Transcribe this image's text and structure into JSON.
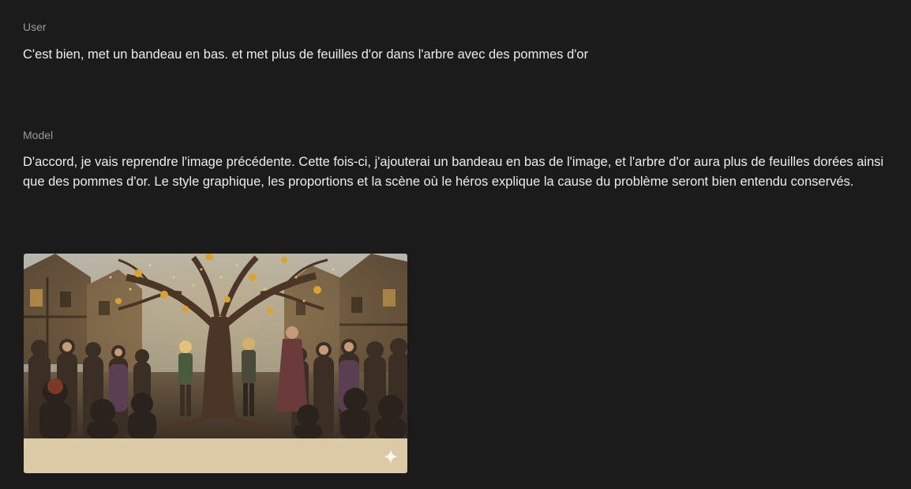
{
  "conversation": {
    "user": {
      "role_label": "User",
      "message": "C'est bien, met un bandeau en bas. et met plus de feuilles d'or dans l'arbre avec des pommes d'or"
    },
    "model": {
      "role_label": "Model",
      "message": "D'accord, je vais reprendre l'image précédente. Cette fois-ci, j'ajouterai un bandeau en bas de l'image, et l'arbre d'or aura plus de feuilles dorées ainsi que des pommes d'or. Le style graphique, les proportions et la scène où le héros explique la cause du problème seront bien entendu conservés.",
      "image": {
        "icon": "sparkle-icon",
        "banner_color": "#dcc9a5"
      }
    }
  },
  "colors": {
    "background": "#1b1b1b",
    "role_text": "#9a9a9a",
    "message_text": "#ececec",
    "golden_apple": "#d9a233"
  }
}
